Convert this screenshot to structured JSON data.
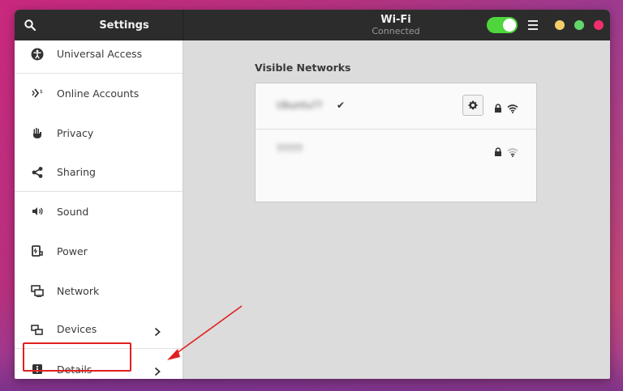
{
  "header": {
    "search_icon": "search-icon",
    "settings_title": "Settings",
    "wifi_title": "Wi-Fi",
    "wifi_status": "Connected",
    "wifi_toggle_on": true,
    "menu_icon": "hamburger-menu-icon"
  },
  "sidebar": {
    "items": [
      {
        "label": "Universal Access",
        "icon": "universal-access-icon"
      },
      {
        "label": "Online Accounts",
        "icon": "online-accounts-icon"
      },
      {
        "label": "Privacy",
        "icon": "hand-icon"
      },
      {
        "label": "Sharing",
        "icon": "share-icon"
      },
      {
        "label": "Sound",
        "icon": "speaker-icon"
      },
      {
        "label": "Power",
        "icon": "power-icon"
      },
      {
        "label": "Network",
        "icon": "network-icon"
      },
      {
        "label": "Devices",
        "icon": "devices-icon"
      },
      {
        "label": "Details",
        "icon": "info-icon"
      }
    ]
  },
  "main": {
    "section_title": "Visible Networks",
    "networks": [
      {
        "name": "Ubuntu??",
        "connected": true,
        "secured": true,
        "signal": "strong"
      },
      {
        "name": "?????",
        "connected": false,
        "secured": true,
        "signal": "weak"
      }
    ]
  },
  "colors": {
    "headerbar": "#2c2c2c",
    "toggle_on": "#4fd63c",
    "minimize": "#f3cf6a",
    "maximize": "#62d66a",
    "close": "#ee2f6b",
    "annotation": "#e02020"
  }
}
